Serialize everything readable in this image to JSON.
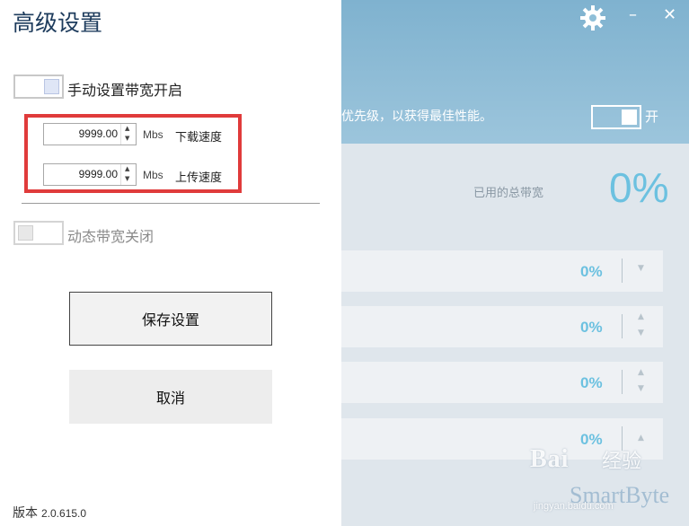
{
  "background": {
    "header_description": "优先级，以获得最佳性能。",
    "header_toggle_label": "开",
    "used_bandwidth_label": "已用的总带宽",
    "used_bandwidth_value": "0%",
    "rows": [
      {
        "value": "0%"
      },
      {
        "value": "0%"
      },
      {
        "value": "0%"
      },
      {
        "value": "0%"
      }
    ],
    "watermark": {
      "baidu_text": "Bai",
      "baidu_suffix": "经验",
      "brand": "SmartByte",
      "url": "jingyan.baidu.com"
    },
    "colors": {
      "header": "#8fbfd8",
      "accent": "#6cc1e0"
    }
  },
  "panel": {
    "title": "高级设置",
    "manual_bandwidth_label": "手动设置带宽开启",
    "download": {
      "value": "9999.00",
      "unit": "Mbs",
      "label": "下载速度"
    },
    "upload": {
      "value": "9999.00",
      "unit": "Mbs",
      "label": "上传速度"
    },
    "dynamic_bandwidth_label": "动态带宽关闭",
    "save_label": "保存设置",
    "cancel_label": "取消",
    "version_label": "版本",
    "version_number": "2.0.615.0",
    "highlight_color": "#e03b3b"
  }
}
